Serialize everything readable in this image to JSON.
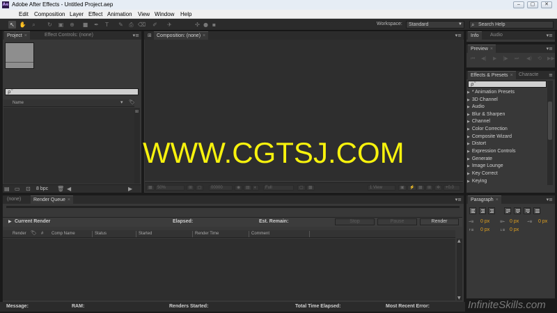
{
  "window": {
    "app_icon": "Ae",
    "title": "Adobe After Effects - Untitled Project.aep",
    "controls": [
      "–",
      "▢",
      "✕"
    ]
  },
  "menu": [
    "Edit",
    "Composition",
    "Layer",
    "Effect",
    "Animation",
    "View",
    "Window",
    "Help"
  ],
  "toolbar": {
    "workspace_label": "Workspace:",
    "workspace_value": "Standard",
    "search_placeholder": "Search Help"
  },
  "project_panel": {
    "tabs": [
      "Project",
      "Effect Controls: (none)"
    ],
    "search_value": "ρ˜",
    "name_column": "Name",
    "bpc": "8 bpc"
  },
  "composition_panel": {
    "tab": "Composition: (none)",
    "zoom": "50%",
    "timecode": "00000",
    "resolution": "Full",
    "view": "1 View",
    "exposure": "+0.0"
  },
  "watermark": "WWW.CGTSJ.COM",
  "render_queue": {
    "tabs": [
      "(none)",
      "Render Queue"
    ],
    "current_render": "Current Render",
    "elapsed": "Elapsed:",
    "est_remain": "Est. Remain:",
    "buttons": [
      "Stop",
      "Pause",
      "Render"
    ],
    "columns": [
      "Render",
      "#",
      "Comp Name",
      "Status",
      "Started",
      "Render Time",
      "Comment"
    ],
    "footer": {
      "message": "Message:",
      "ram": "RAM:",
      "renders_started": "Renders Started:",
      "total_time": "Total Time Elapsed:",
      "recent_error": "Most Recent Error:"
    }
  },
  "info_panel": {
    "tabs": [
      "Info",
      "Audio"
    ]
  },
  "preview_panel": {
    "tab": "Preview"
  },
  "effects_panel": {
    "tabs": [
      "Effects & Presets",
      "Characte"
    ],
    "search_value": "ρ˜",
    "items": [
      "* Animation Presets",
      "3D Channel",
      "Audio",
      "Blur & Sharpen",
      "Channel",
      "Color Correction",
      "Composite Wizard",
      "Distort",
      "Expression Controls",
      "Generate",
      "Image Lounge",
      "Key Correct",
      "Keying"
    ]
  },
  "paragraph_panel": {
    "tab": "Paragraph",
    "values": [
      "0 px",
      "0 px",
      "0 px",
      "0 px",
      "0 px"
    ]
  },
  "brand": "InfiniteSkills.com"
}
